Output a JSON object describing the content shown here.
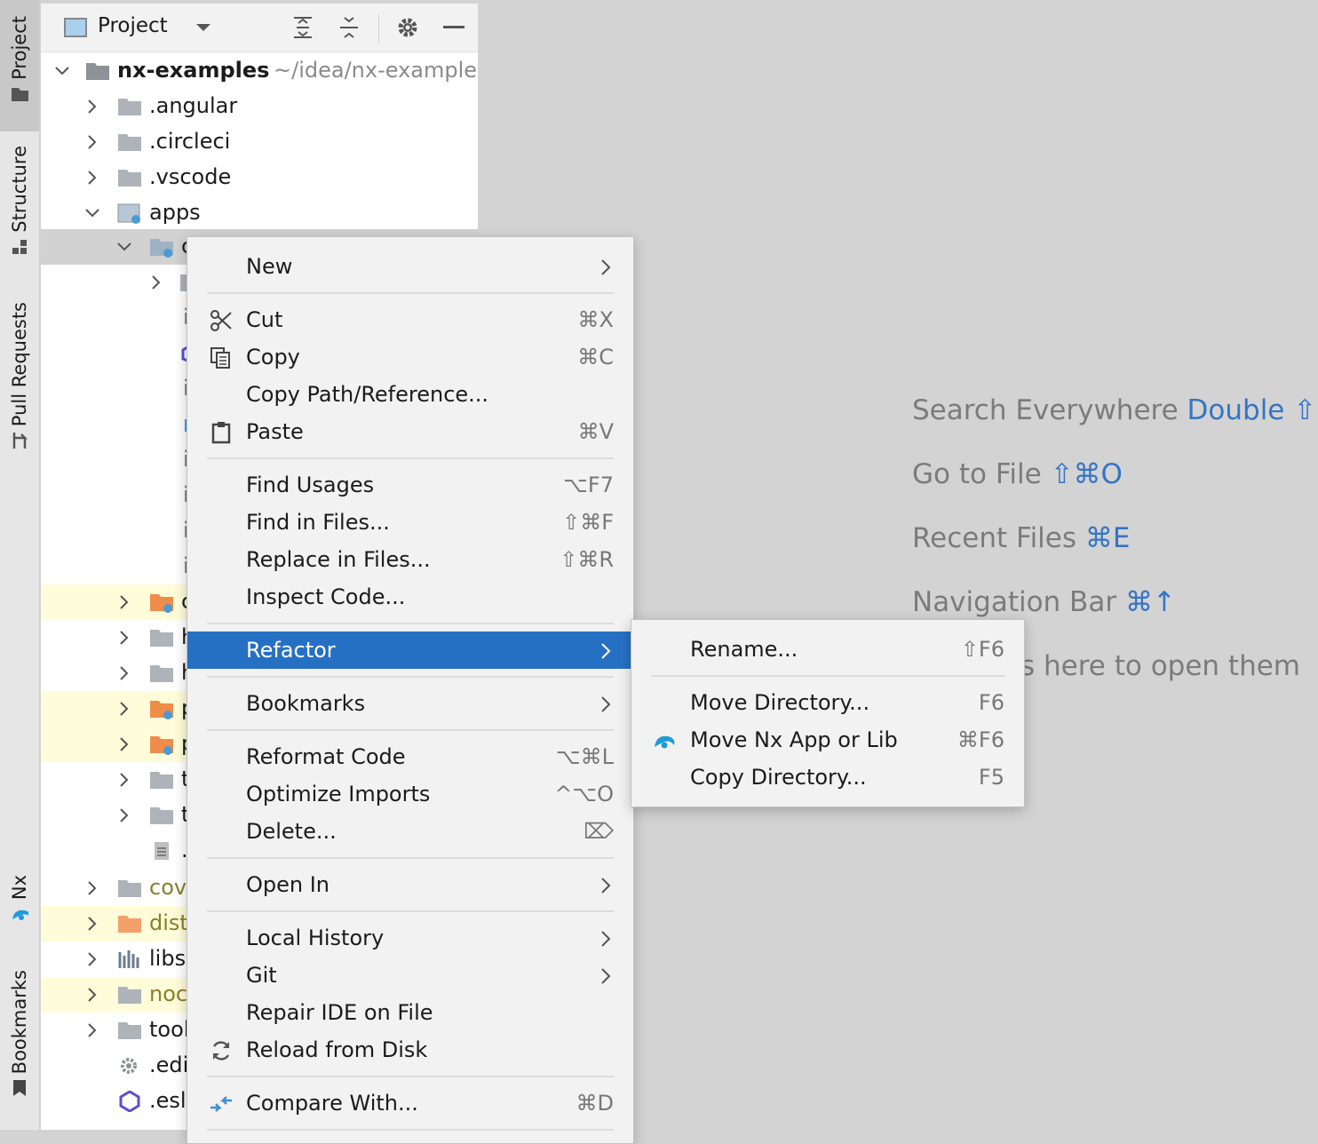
{
  "stripe": {
    "tabs": [
      {
        "label": "Project",
        "icon": "folder-icon",
        "active": true
      },
      {
        "label": "Structure",
        "icon": "structure-icon"
      },
      {
        "label": "Pull Requests",
        "icon": "pull-request-icon"
      },
      {
        "label": "Nx",
        "icon": "nx-icon"
      },
      {
        "label": "Bookmarks",
        "icon": "bookmark-icon"
      }
    ]
  },
  "project_panel": {
    "title": "Project",
    "tree": [
      {
        "label": "nx-examples",
        "path": "~/idea/nx-examples",
        "expanded": true,
        "bold": true
      },
      {
        "label": ".angular",
        "expanded": false
      },
      {
        "label": ".circleci",
        "expanded": false
      },
      {
        "label": ".vscode",
        "expanded": false
      },
      {
        "label": "apps",
        "expanded": true
      },
      {
        "label": "c",
        "expanded": true
      },
      {
        "label": "",
        "expanded": false
      },
      {
        "label": "i"
      },
      {
        "label": ""
      },
      {
        "label": "i"
      },
      {
        "label": ""
      },
      {
        "label": "i"
      },
      {
        "label": "i"
      },
      {
        "label": "i"
      },
      {
        "label": "i"
      },
      {
        "label": "c"
      },
      {
        "label": "h"
      },
      {
        "label": "h"
      },
      {
        "label": "p"
      },
      {
        "label": "p"
      },
      {
        "label": "t"
      },
      {
        "label": "t"
      },
      {
        "label": "."
      },
      {
        "label": "cov"
      },
      {
        "label": "dist"
      },
      {
        "label": "libs"
      },
      {
        "label": "noc"
      },
      {
        "label": "tool"
      },
      {
        "label": ".edi"
      },
      {
        "label": ".esl"
      }
    ]
  },
  "editor_hints": [
    {
      "text": "Search Everywhere",
      "key": "Double ⇧"
    },
    {
      "text": "Go to File",
      "key": "⇧⌘O"
    },
    {
      "text": "Recent Files",
      "key": "⌘E"
    },
    {
      "text": "Navigation Bar",
      "key": "⌘↑"
    },
    {
      "text": "s here to open them",
      "key": ""
    }
  ],
  "context_menu": {
    "items": [
      {
        "label": "New",
        "submenu": true
      },
      {
        "label": "Cut",
        "shortcut": "⌘X",
        "icon": "cut-icon"
      },
      {
        "label": "Copy",
        "shortcut": "⌘C",
        "icon": "copy-icon"
      },
      {
        "label": "Copy Path/Reference..."
      },
      {
        "label": "Paste",
        "shortcut": "⌘V",
        "icon": "paste-icon"
      },
      {
        "label": "Find Usages",
        "shortcut": "⌥F7"
      },
      {
        "label": "Find in Files...",
        "shortcut": "⇧⌘F"
      },
      {
        "label": "Replace in Files...",
        "shortcut": "⇧⌘R"
      },
      {
        "label": "Inspect Code..."
      },
      {
        "label": "Refactor",
        "submenu": true,
        "selected": true
      },
      {
        "label": "Bookmarks",
        "submenu": true
      },
      {
        "label": "Reformat Code",
        "shortcut": "⌥⌘L"
      },
      {
        "label": "Optimize Imports",
        "shortcut": "^⌥O"
      },
      {
        "label": "Delete...",
        "shortcut": "⌦"
      },
      {
        "label": "Open In",
        "submenu": true
      },
      {
        "label": "Local History",
        "submenu": true
      },
      {
        "label": "Git",
        "submenu": true
      },
      {
        "label": "Repair IDE on File"
      },
      {
        "label": "Reload from Disk",
        "icon": "reload-icon"
      },
      {
        "label": "Compare With...",
        "shortcut": "⌘D",
        "icon": "compare-icon"
      }
    ]
  },
  "refactor_submenu": {
    "items": [
      {
        "label": "Rename...",
        "shortcut": "⇧F6"
      },
      {
        "label": "Move Directory...",
        "shortcut": "F6"
      },
      {
        "label": "Move Nx App or Lib",
        "shortcut": "⌘F6",
        "icon": "nx-icon"
      },
      {
        "label": "Copy Directory...",
        "shortcut": "F5"
      }
    ]
  },
  "colors": {
    "accent": "#2670c4",
    "hint_key": "#3574c4",
    "highlight_yellow": "#fefcd9",
    "nx_blue": "#1e9bd7"
  }
}
